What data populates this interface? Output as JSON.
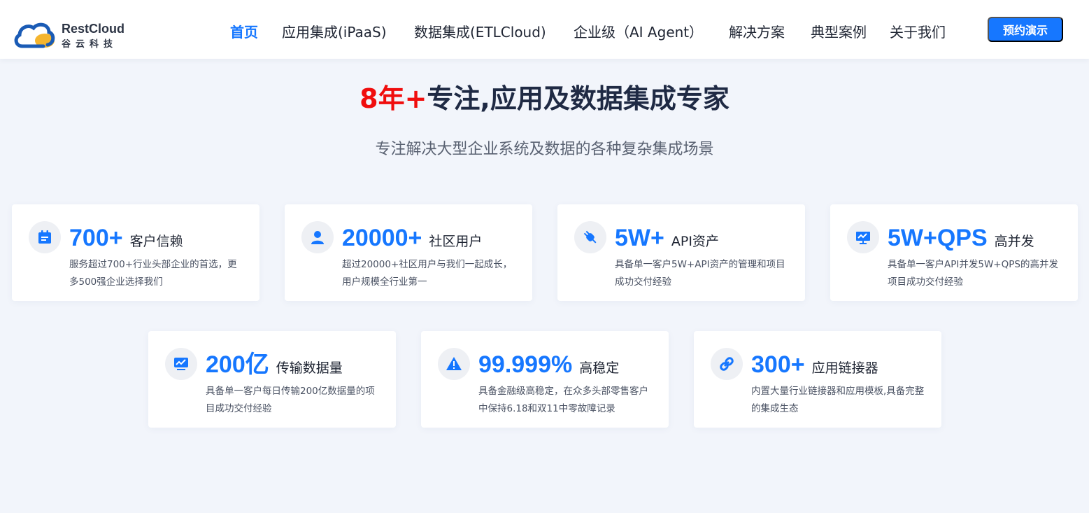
{
  "brand": {
    "name": "RestCloud",
    "subtitle": "谷云科技",
    "colors": {
      "primary": "#1677ff",
      "accent": "#f00d0d",
      "logo_blue": "#1a5bb5",
      "logo_yellow": "#f5b52e"
    }
  },
  "nav": {
    "items": [
      {
        "label": "首页",
        "active": true
      },
      {
        "label": "应用集成(iPaaS)"
      },
      {
        "label": "数据集成(ETLCloud)"
      },
      {
        "label": "企业级（AI Agent）"
      },
      {
        "label": "解决方案"
      },
      {
        "label": "典型案例"
      },
      {
        "label": "关于我们"
      }
    ],
    "cta_label": "预约演示"
  },
  "hero": {
    "headline_accent": "8年+",
    "headline_rest": "专注,应用及数据集成专家",
    "subheadline": "专注解决大型企业系统及数据的各种复杂集成场景"
  },
  "stats": [
    {
      "icon": "calendar-icon",
      "value": "700+",
      "label": "客户信赖",
      "desc": "服务超过700+行业头部企业的首选，更多500强企业选择我们"
    },
    {
      "icon": "user-icon",
      "value": "20000+",
      "label": "社区用户",
      "desc": "超过20000+社区用户与我们一起成长，用户规模全行业第一"
    },
    {
      "icon": "plug-icon",
      "value": "5W+",
      "label": "API资产",
      "desc": "具备单一客户5W+API资产的管理和项目成功交付经验"
    },
    {
      "icon": "presentation-chart-icon",
      "value": "5W+QPS",
      "label": "高并发",
      "desc": "具备单一客户API并发5W+QPS的高并发项目成功交付经验"
    },
    {
      "icon": "monitor-chart-icon",
      "value": "200亿",
      "label": "传输数据量",
      "desc": "具备单一客户每日传输200亿数据量的项目成功交付经验"
    },
    {
      "icon": "warning-icon",
      "value": "99.999%",
      "label": "高稳定",
      "desc": "具备金融级高稳定，在众多头部零售客户中保持6.18和双11中零故障记录"
    },
    {
      "icon": "link-icon",
      "value": "300+",
      "label": "应用链接器",
      "desc": "内置大量行业链接器和应用模板,具备完整的集成生态"
    }
  ]
}
